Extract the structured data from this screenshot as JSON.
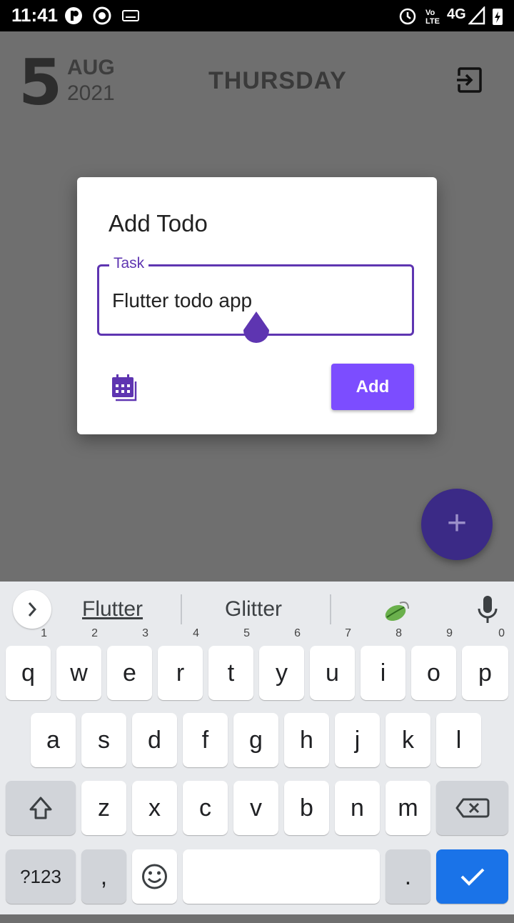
{
  "status_bar": {
    "time": "11:41",
    "network": "4G",
    "icons": [
      "notification-app-icon",
      "record-icon",
      "keyboard-icon",
      "alarm-icon",
      "volte-icon",
      "signal-icon",
      "battery-charging-icon"
    ]
  },
  "header": {
    "day": "5",
    "month": "AUG",
    "year": "2021",
    "weekday": "THURSDAY",
    "logout_icon": "logout-icon"
  },
  "dialog": {
    "title": "Add Todo",
    "task_label": "Task",
    "task_value": "Flutter todo app",
    "calendar_icon": "calendar-icon",
    "add_label": "Add"
  },
  "fab": {
    "label": "+"
  },
  "keyboard": {
    "suggestions": [
      "Flutter",
      "Glitter"
    ],
    "row1": [
      "q",
      "w",
      "e",
      "r",
      "t",
      "y",
      "u",
      "i",
      "o",
      "p"
    ],
    "row1_hints": [
      "1",
      "2",
      "3",
      "4",
      "5",
      "6",
      "7",
      "8",
      "9",
      "0"
    ],
    "row2": [
      "a",
      "s",
      "d",
      "f",
      "g",
      "h",
      "j",
      "k",
      "l"
    ],
    "row3": [
      "z",
      "x",
      "c",
      "v",
      "b",
      "n",
      "m"
    ],
    "symbols_label": "?123",
    "comma": ",",
    "period": "."
  },
  "colors": {
    "accent": "#7c4dff",
    "field_border": "#5e35b1",
    "fab": "#3b2a86",
    "enter_key": "#1a73e8"
  }
}
